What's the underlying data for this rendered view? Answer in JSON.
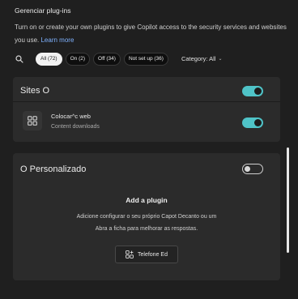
{
  "header": {
    "title": "Gerenciar plug-ins",
    "description": "Turn on or create your own plugins to give Copilot access to the security services and websites you use.",
    "learn_more": "Learn more"
  },
  "filters": {
    "search_icon": "search-icon",
    "pills": [
      {
        "label": "All (72)",
        "active": true
      },
      {
        "label": "On (2)",
        "active": false
      },
      {
        "label": "Off (34)",
        "active": false
      },
      {
        "label": "Not set up (36)",
        "active": false
      }
    ],
    "category_label": "Category: All",
    "category_icon": "chevron-down-icon"
  },
  "sections": {
    "sites": {
      "title": "Sites O",
      "toggle_on": true,
      "plugin": {
        "name": "Colocar^c web",
        "subtitle": "Content downloads",
        "icon": "grid-icon",
        "toggle_on": true
      }
    },
    "custom": {
      "title": "O Personalizado",
      "toggle_on": false,
      "add_title": "Add a plugin",
      "add_line1": "Adicione configurar o seu próprio Capot Decanto ou um",
      "add_line2": "Abra a ficha para melhorar as respostas.",
      "add_button": "Telefone Ed",
      "add_button_icon": "grid-add-icon"
    }
  },
  "colors": {
    "background": "#1f1f1f",
    "card": "#2b2b2b",
    "toggle_on": "#4fc3c7",
    "link": "#7fb2ff"
  }
}
